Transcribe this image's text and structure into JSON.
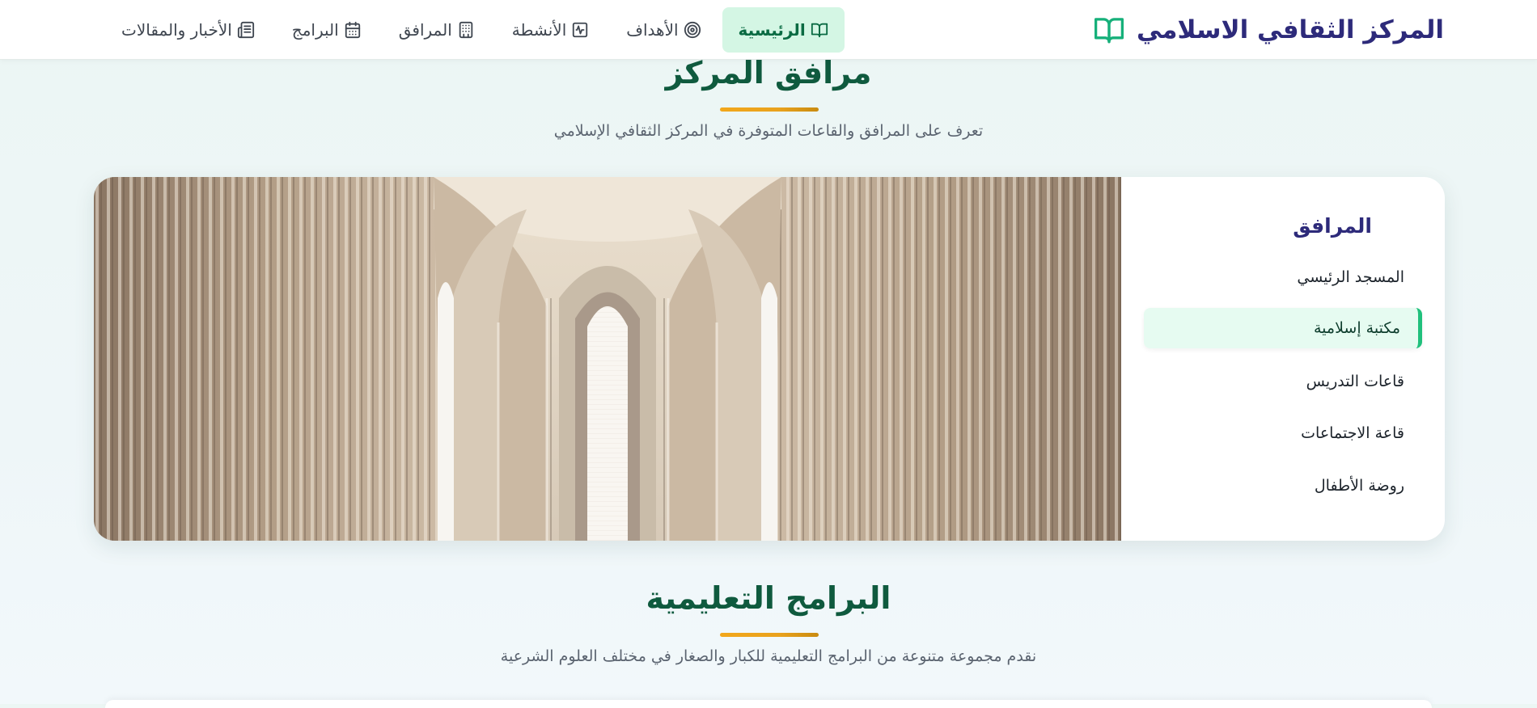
{
  "header": {
    "brand_name": "المركز الثقافي الاسلامي",
    "brand_icon": "open-book-icon",
    "nav": [
      {
        "key": "home",
        "label": "الرئيسية",
        "icon": "book-open-icon",
        "active": true
      },
      {
        "key": "goals",
        "label": "الأهداف",
        "icon": "target-icon",
        "active": false
      },
      {
        "key": "activities",
        "label": "الأنشطة",
        "icon": "activity-icon",
        "active": false
      },
      {
        "key": "facilities",
        "label": "المرافق",
        "icon": "building-icon",
        "active": false
      },
      {
        "key": "programs",
        "label": "البرامج",
        "icon": "calendar-icon",
        "active": false
      },
      {
        "key": "news",
        "label": "الأخبار والمقالات",
        "icon": "newspaper-icon",
        "active": false
      }
    ]
  },
  "facilities_section": {
    "title": "مرافق المركز",
    "subtitle": "تعرف على المرافق والقاعات المتوفرة في المركز الثقافي الإسلامي",
    "sidebar_title": "المرافق",
    "items": [
      {
        "label": "المسجد الرئيسي",
        "active": false
      },
      {
        "label": "مكتبة إسلامية",
        "active": true
      },
      {
        "label": "قاعات التدريس",
        "active": false
      },
      {
        "label": "قاعة الاجتماعات",
        "active": false
      },
      {
        "label": "روضة الأطفال",
        "active": false
      }
    ],
    "image": "arched-hall-interior-image"
  },
  "programs_section": {
    "title": "البرامج التعليمية",
    "subtitle": "نقدم مجموعة متنوعة من البرامج التعليمية للكبار والصغار في مختلف العلوم الشرعية"
  },
  "colors": {
    "primary_green": "#0f5a3e",
    "active_green_bg": "#d4f6e4",
    "brand_navy": "#2d2a7a",
    "accent_gold": "#e9a21d"
  }
}
